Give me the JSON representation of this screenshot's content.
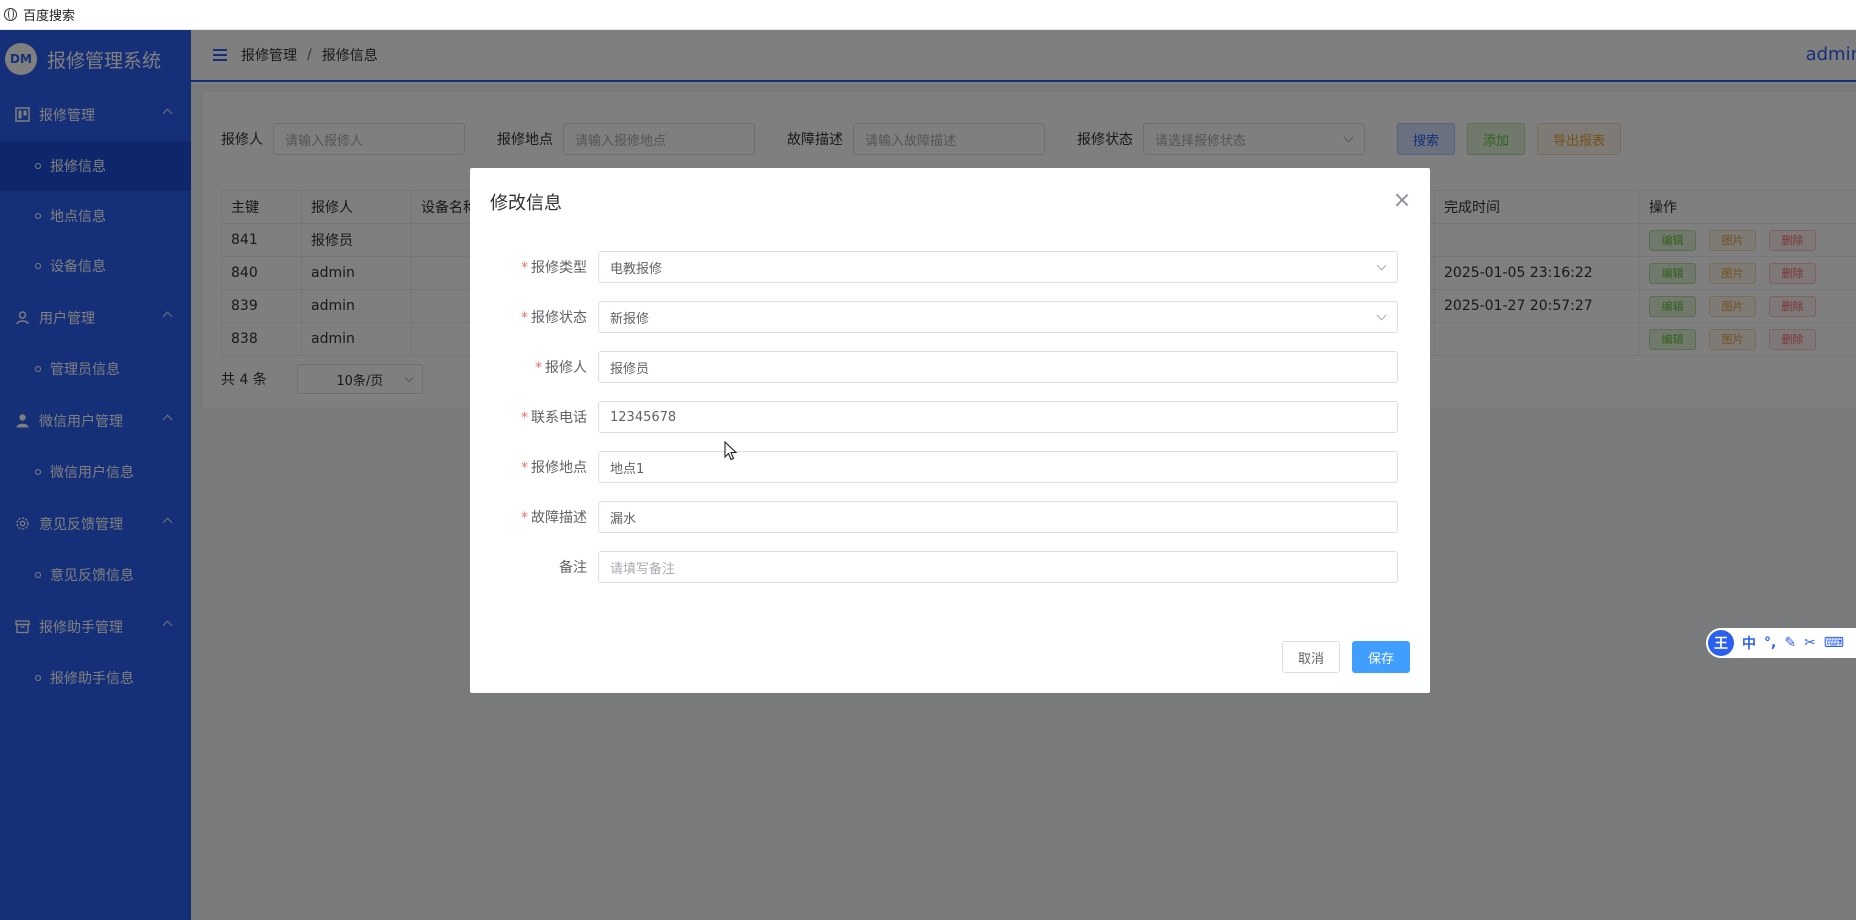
{
  "browser": {
    "tab_title": "百度搜索"
  },
  "sidebar": {
    "logo_badge": "DM",
    "title": "报修管理系统",
    "groups": [
      {
        "label": "报修管理",
        "icon": "book-icon",
        "items": [
          {
            "label": "报修信息",
            "active": true
          },
          {
            "label": "地点信息"
          },
          {
            "label": "设备信息"
          }
        ]
      },
      {
        "label": "用户管理",
        "icon": "user-outline-icon",
        "items": [
          {
            "label": "管理员信息"
          }
        ]
      },
      {
        "label": "微信用户管理",
        "icon": "user-filled-icon",
        "items": [
          {
            "label": "微信用户信息"
          }
        ]
      },
      {
        "label": "意见反馈管理",
        "icon": "gear-icon",
        "items": [
          {
            "label": "意见反馈信息"
          }
        ]
      },
      {
        "label": "报修助手管理",
        "icon": "box-icon",
        "items": [
          {
            "label": "报修助手信息"
          }
        ]
      }
    ]
  },
  "header": {
    "breadcrumb": [
      "报修管理",
      "报修信息"
    ],
    "separator": "/",
    "user": "admin"
  },
  "search": {
    "fields": [
      {
        "label": "报修人",
        "placeholder": "请输入报修人"
      },
      {
        "label": "报修地点",
        "placeholder": "请输入报修地点"
      },
      {
        "label": "故障描述",
        "placeholder": "请输入故障描述"
      },
      {
        "label": "报修状态",
        "placeholder": "请选择报修状态"
      }
    ],
    "buttons": {
      "search": "搜索",
      "add": "添加",
      "export": "导出报表"
    }
  },
  "table": {
    "columns": [
      "主键",
      "报修人",
      "设备名称",
      "完成时间",
      "操作"
    ],
    "rows": [
      {
        "id": "841",
        "reporter": "报修员",
        "device": "",
        "finish": ""
      },
      {
        "id": "840",
        "reporter": "admin",
        "device": "",
        "finish": "2025-01-05 23:16:22"
      },
      {
        "id": "839",
        "reporter": "admin",
        "device": "",
        "finish": "2025-01-27 20:57:27"
      },
      {
        "id": "838",
        "reporter": "admin",
        "device": "",
        "finish": ""
      }
    ],
    "ops": {
      "edit": "编辑",
      "image": "图片",
      "delete": "删除"
    }
  },
  "pager": {
    "total": "共 4 条",
    "page_size": "10条/页"
  },
  "dialog": {
    "title": "修改信息",
    "fields": [
      {
        "label": "报修类型",
        "required": true,
        "value": "电教报修",
        "type": "select"
      },
      {
        "label": "报修状态",
        "required": true,
        "value": "新报修",
        "type": "select"
      },
      {
        "label": "报修人",
        "required": true,
        "value": "报修员",
        "type": "input"
      },
      {
        "label": "联系电话",
        "required": true,
        "value": "12345678",
        "type": "input"
      },
      {
        "label": "报修地点",
        "required": true,
        "value": "地点1",
        "type": "input"
      },
      {
        "label": "故障描述",
        "required": true,
        "value": "漏水",
        "type": "input"
      },
      {
        "label": "备注",
        "required": false,
        "value": "",
        "placeholder": "请填写备注",
        "type": "input"
      }
    ],
    "cancel": "取消",
    "save": "保存"
  },
  "ime": {
    "logo": "王",
    "mode": "中"
  },
  "colors": {
    "primary": "#2b5ff0",
    "save": "#409eff",
    "required": "#f56c6c"
  }
}
